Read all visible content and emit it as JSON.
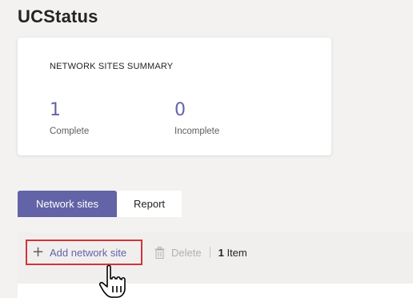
{
  "app": {
    "title": "UCStatus"
  },
  "summary": {
    "heading": "NETWORK SITES SUMMARY",
    "stats": [
      {
        "value": "1",
        "label": "Complete"
      },
      {
        "value": "0",
        "label": "Incomplete"
      }
    ],
    "accent_color": "#6264a7"
  },
  "tabs": [
    {
      "label": "Network sites",
      "active": true
    },
    {
      "label": "Report",
      "active": false
    }
  ],
  "toolbar": {
    "add_label": "Add network site",
    "add_icon": "plus-icon",
    "delete_label": "Delete",
    "delete_icon": "trash-icon",
    "count_number": "1",
    "count_suffix": "Item",
    "highlight_color": "#d13438"
  }
}
